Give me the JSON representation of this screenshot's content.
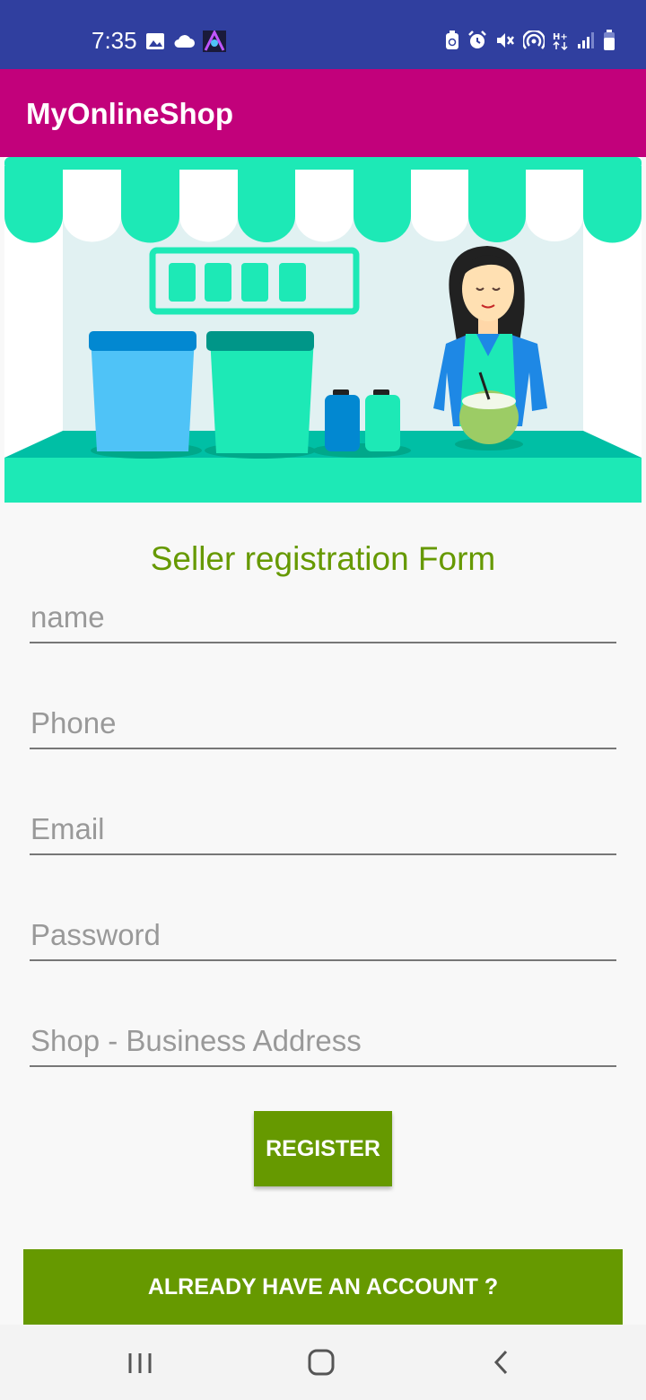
{
  "status": {
    "time": "7:35",
    "icons": [
      "image-icon",
      "cloud-icon",
      "app-icon",
      "battery-saver-icon",
      "alarm-icon",
      "mute-icon",
      "hotspot-icon",
      "network-type-icon",
      "signal-icon",
      "battery-icon"
    ]
  },
  "app": {
    "title": "MyOnlineShop"
  },
  "hero": {
    "description": "Illustration of a shop stall with a shopkeeper"
  },
  "form": {
    "title": "Seller registration Form",
    "fields": [
      {
        "placeholder": "name",
        "value": ""
      },
      {
        "placeholder": "Phone",
        "value": ""
      },
      {
        "placeholder": "Email",
        "value": ""
      },
      {
        "placeholder": "Password",
        "value": ""
      },
      {
        "placeholder": "Shop - Business Address",
        "value": ""
      }
    ],
    "register_label": "REGISTER",
    "account_label": "ALREADY HAVE AN ACCOUNT ?"
  },
  "nav": {
    "icons": [
      "recent-apps-icon",
      "home-icon",
      "back-icon"
    ]
  },
  "colors": {
    "status_bar": "#303f9f",
    "app_bar": "#c2017b",
    "accent": "#669900",
    "mint": "#1de9b6"
  }
}
